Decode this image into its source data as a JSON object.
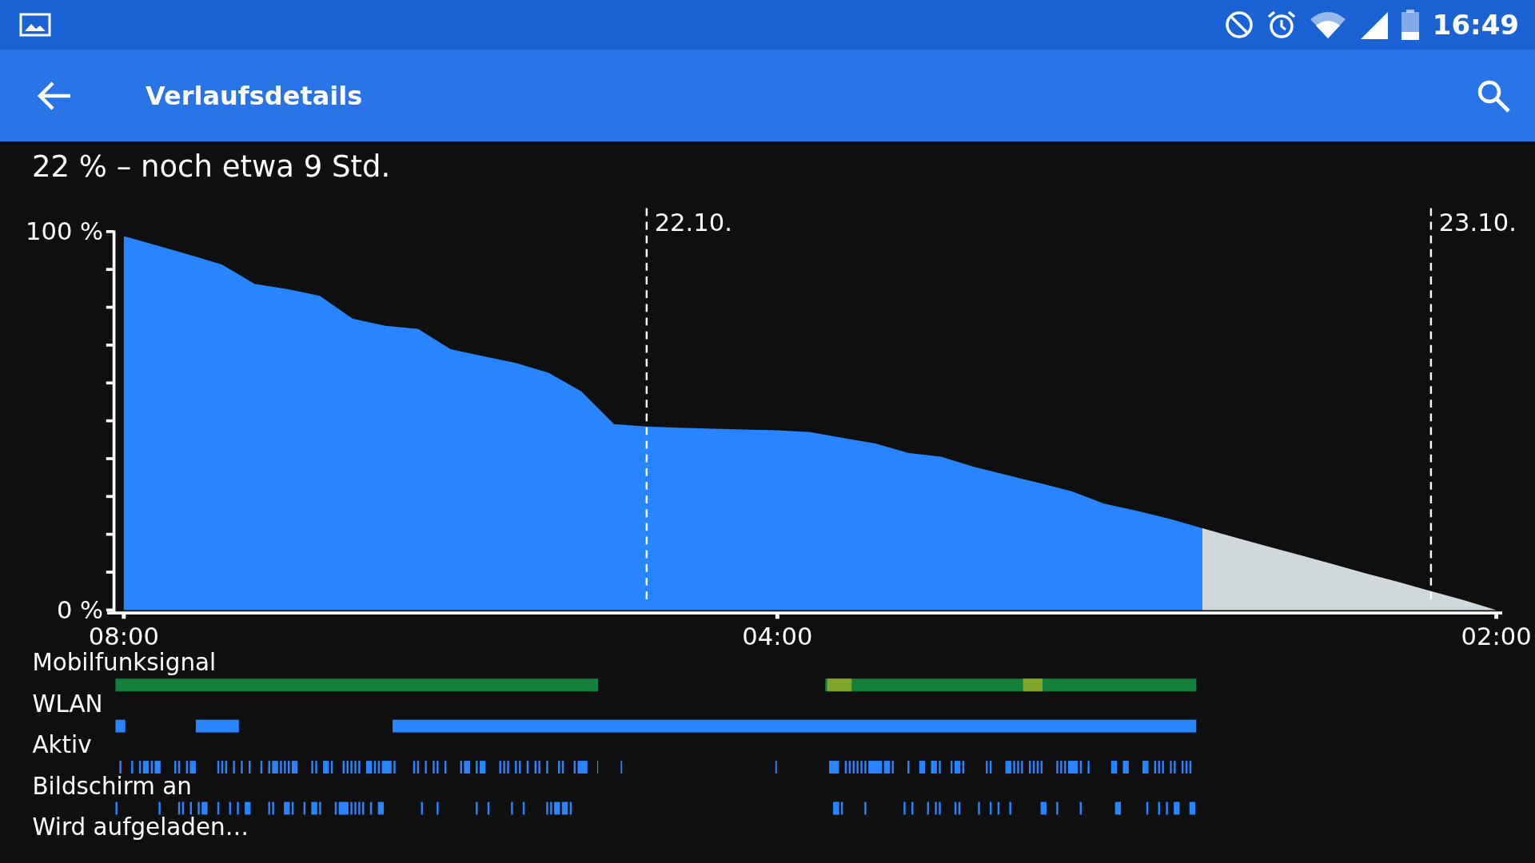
{
  "status_bar": {
    "time": "16:49"
  },
  "toolbar": {
    "title": "Verlaufsdetails"
  },
  "summary": "22 % – noch etwa 9 Std.",
  "chart": {
    "chart_data": {
      "type": "area",
      "categories": [
        "08:00",
        null,
        null,
        null,
        null,
        null,
        null,
        null,
        null,
        null,
        null,
        null,
        null,
        null,
        null,
        null,
        null,
        null,
        null,
        null,
        "04:00",
        null,
        null,
        null,
        null,
        null,
        null,
        null,
        null,
        null,
        null,
        null,
        null,
        null,
        null,
        null,
        null,
        null,
        null,
        null,
        null,
        null,
        "02:00"
      ],
      "series": [
        {
          "color": "#2984ff",
          "values": [
            98.8,
            96.4,
            93.9,
            91.3,
            86.2,
            84.8,
            83,
            77,
            75.1,
            74.3,
            68.9,
            67.1,
            65.3,
            62.7,
            57.8,
            49.1,
            48.5,
            48.2,
            47.9,
            47.7,
            47.5,
            47,
            45.5,
            44,
            41.5,
            40.5,
            37.9,
            35.7,
            33.6,
            31.4,
            28.1,
            26.2,
            24.1,
            21.6,
            null,
            null,
            null,
            null,
            null,
            null,
            null,
            null,
            null
          ]
        },
        {
          "color": "#d0d8db",
          "values": [
            null,
            null,
            null,
            null,
            null,
            null,
            null,
            null,
            null,
            null,
            null,
            null,
            null,
            null,
            null,
            null,
            null,
            null,
            null,
            null,
            null,
            null,
            null,
            null,
            null,
            null,
            null,
            null,
            null,
            null,
            null,
            null,
            null,
            21.6,
            19.2,
            16.8,
            14.5,
            12.1,
            9.7,
            7.4,
            5,
            2.6,
            0
          ]
        }
      ],
      "ylim": [
        0,
        100
      ],
      "yticks": [
        {
          "value": 0,
          "label": "0 %"
        },
        {
          "value": 100,
          "label": "100 %"
        }
      ],
      "annotations": [
        "22.10.",
        "23.10."
      ]
    }
  },
  "tracks": [
    {
      "label": "Mobilfunksignal",
      "kind": "band",
      "color": "#13803d"
    },
    {
      "label": "WLAN",
      "kind": "band",
      "color": "#2984ff"
    },
    {
      "label": "Aktiv",
      "kind": "ticks",
      "color": "#2984ff"
    },
    {
      "label": "Bildschirm an",
      "kind": "ticks",
      "color": "#2984ff"
    },
    {
      "label": "Wird aufgeladen…",
      "kind": "none"
    }
  ]
}
